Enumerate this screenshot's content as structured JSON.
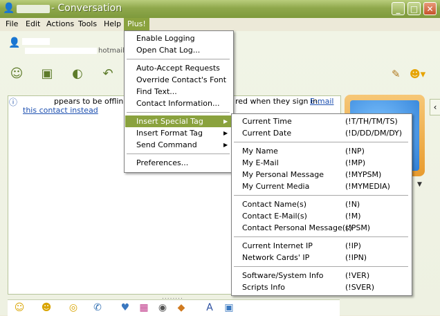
{
  "window": {
    "title": "- Conversation",
    "minimize_glyph": "_",
    "maximize_glyph": "□",
    "close_glyph": "✕"
  },
  "menubar": [
    "File",
    "Edit",
    "Actions",
    "Tools",
    "Help",
    "Plus!"
  ],
  "contact": {
    "email_partial": "hotmail"
  },
  "info_bar": {
    "text_part1": "ppears to be offline.",
    "text_part2": "red when they sign in.",
    "link_part1": "E-mail",
    "link_part2": "this contact instead"
  },
  "plus_menu": {
    "group1": [
      "Enable Logging",
      "Open Chat Log..."
    ],
    "group2": [
      "Auto-Accept Requests",
      "Override Contact's Font",
      "Find Text...",
      "Contact Information..."
    ],
    "group3": [
      "Insert Special Tag",
      "Insert Format Tag",
      "Send Command"
    ],
    "group4": [
      "Preferences..."
    ]
  },
  "special_tag_menu": {
    "group1": [
      {
        "label": "Current Time",
        "tag": "(!T/TH/TM/TS)"
      },
      {
        "label": "Current Date",
        "tag": "(!D/DD/DM/DY)"
      }
    ],
    "group2": [
      {
        "label": "My Name",
        "tag": "(!NP)"
      },
      {
        "label": "My E-Mail",
        "tag": "(!MP)"
      },
      {
        "label": "My Personal Message",
        "tag": "(!MYPSM)"
      },
      {
        "label": "My Current Media",
        "tag": "(!MYMEDIA)"
      }
    ],
    "group3": [
      {
        "label": "Contact Name(s)",
        "tag": "(!N)"
      },
      {
        "label": "Contact E-Mail(s)",
        "tag": "(!M)"
      },
      {
        "label": "Contact Personal Message(s)",
        "tag": "(!PSM)"
      }
    ],
    "group4": [
      {
        "label": "Current Internet IP",
        "tag": "(!IP)"
      },
      {
        "label": "Network Cards' IP",
        "tag": "(!IPN)"
      }
    ],
    "group5": [
      {
        "label": "Software/System Info",
        "tag": "(!VER)"
      },
      {
        "label": "Scripts Info",
        "tag": "(!SVER)"
      }
    ]
  },
  "colors": {
    "titlebar": "#8fa84c",
    "menu_highlight": "#8aa23e"
  },
  "icons": [
    "messenger-buddy-icon",
    "invite-contact-icon",
    "send-files-icon",
    "voice-icon",
    "call-icon",
    "brush-icon",
    "emoticon-icon",
    "nudge-icon",
    "winks-icon",
    "backgrounds-icon",
    "font-icon"
  ]
}
